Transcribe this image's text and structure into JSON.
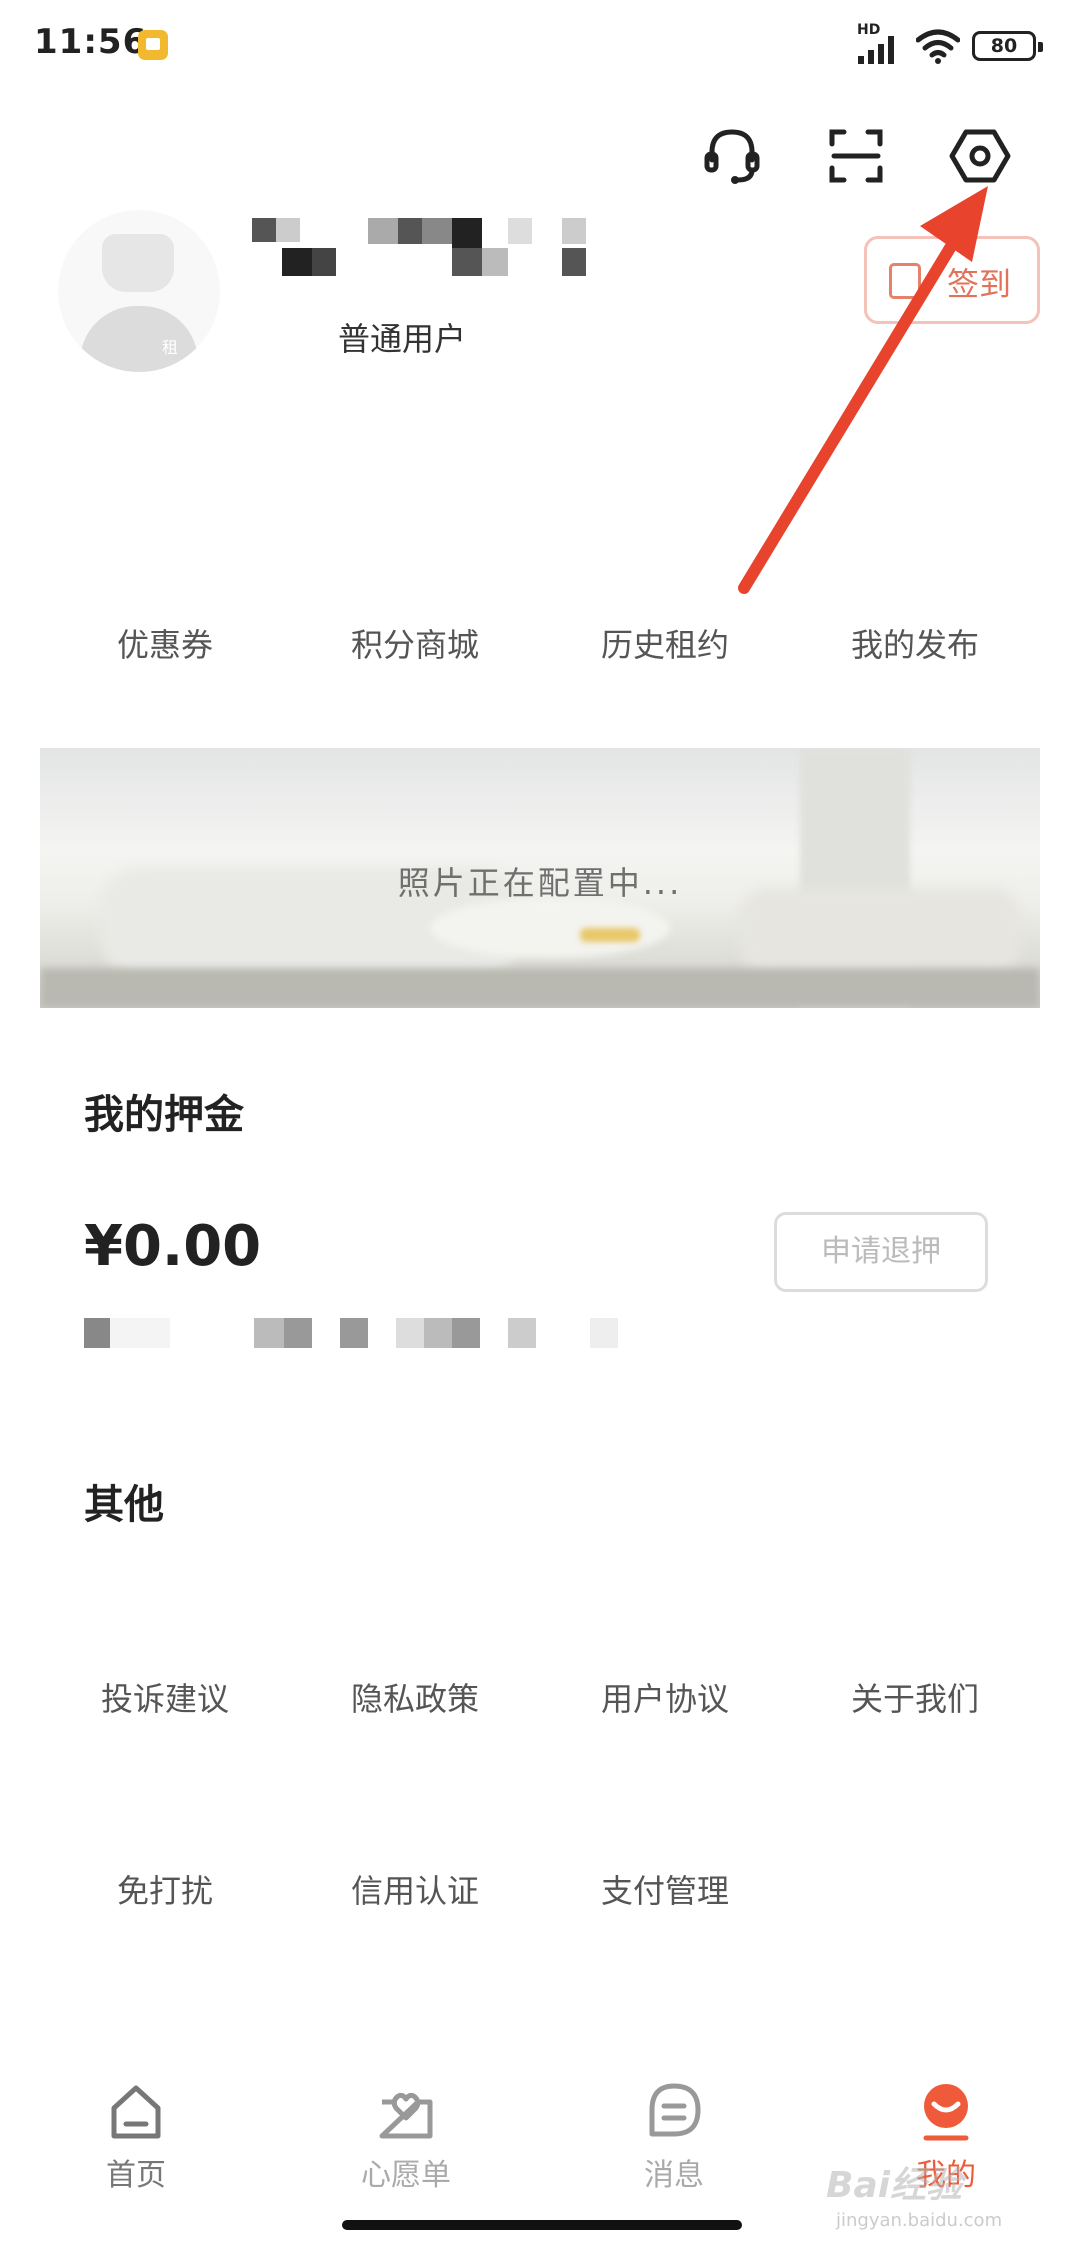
{
  "status_bar": {
    "time": "11:56",
    "network": "HD",
    "battery": "80"
  },
  "header": {
    "icons": [
      "headset-icon",
      "scan-icon",
      "settings-icon"
    ]
  },
  "profile": {
    "avatar_tag": "租",
    "user_level": "普通用户",
    "checkin_label": "签到"
  },
  "quick_menu": {
    "items": [
      "优惠券",
      "积分商城",
      "历史租约",
      "我的发布"
    ]
  },
  "banner": {
    "text": "照片正在配置中..."
  },
  "deposit": {
    "title": "我的押金",
    "amount": "¥0.00",
    "refund_label": "申请退押"
  },
  "other": {
    "title": "其他",
    "items": [
      "投诉建议",
      "隐私政策",
      "用户协议",
      "关于我们",
      "免打扰",
      "信用认证",
      "支付管理"
    ]
  },
  "bottom_nav": {
    "tabs": [
      "首页",
      "心愿单",
      "消息",
      "我的"
    ],
    "active_color": "#ee5a3a"
  },
  "overlay": {
    "arrow_color": "#e8432d"
  },
  "watermark": {
    "text": "Bai经验",
    "url": "jingyan.baidu.com"
  }
}
